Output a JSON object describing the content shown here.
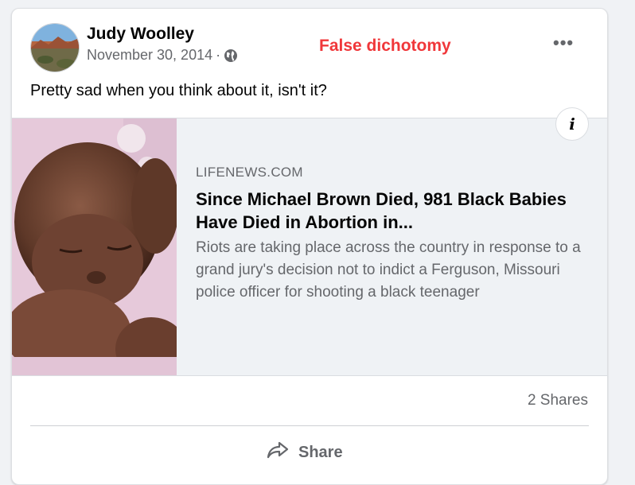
{
  "post": {
    "author": "Judy Woolley",
    "date": "November 30, 2014",
    "separator": "·",
    "privacy_icon": "globe-icon",
    "text": "Pretty sad when you think about it, isn't it?",
    "more_label": "•••"
  },
  "annotation": {
    "text": "False dichotomy",
    "color": "#f0373a"
  },
  "link_preview": {
    "domain": "LIFENEWS.COM",
    "title": "Since Michael Brown Died, 981 Black Babies Have Died in Abortion in...",
    "description": "Riots are taking place across the country in response to a grand jury's decision not to indict a Ferguson, Missouri police officer for shooting a black teenager",
    "info_label": "i"
  },
  "stats": {
    "shares": "2 Shares"
  },
  "actions": {
    "share_label": "Share"
  }
}
